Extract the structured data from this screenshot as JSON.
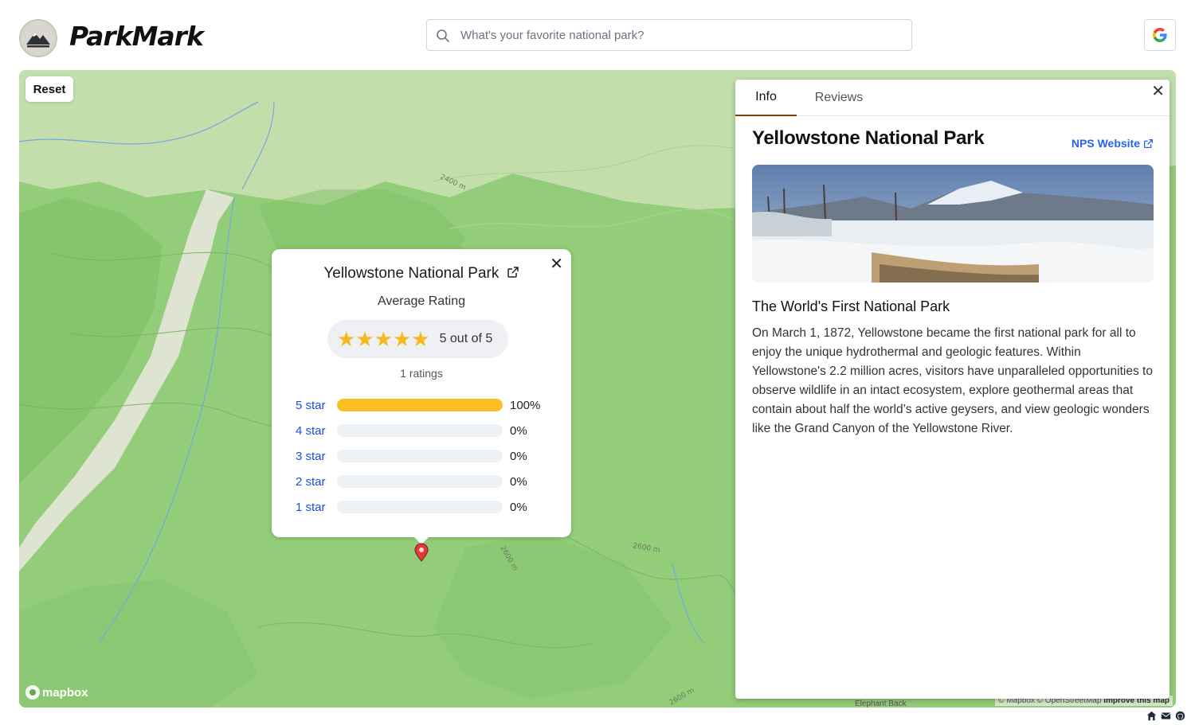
{
  "header": {
    "brand": "ParkMark",
    "search_placeholder": "What's your favorite national park?",
    "google_button_icon": "google-icon"
  },
  "map": {
    "reset_label": "Reset",
    "mapbox_label": "mapbox",
    "attribution_text": "© Mapbox © OpenStreetMap ",
    "attribution_link": "Improve this map",
    "contour_labels": [
      "2400 m",
      "2600 m",
      "2600 m",
      "2600 m"
    ],
    "place_label": "Elephant Back"
  },
  "popup": {
    "title": "Yellowstone National Park",
    "avg_label": "Average Rating",
    "rating": 5,
    "rating_text": "5 out of 5",
    "ratings_count": "1 ratings",
    "histogram": [
      {
        "label": "5 star",
        "fraction": 1.0,
        "pct": "100%"
      },
      {
        "label": "4 star",
        "fraction": 0.0,
        "pct": "0%"
      },
      {
        "label": "3 star",
        "fraction": 0.0,
        "pct": "0%"
      },
      {
        "label": "2 star",
        "fraction": 0.0,
        "pct": "0%"
      },
      {
        "label": "1 star",
        "fraction": 0.0,
        "pct": "0%"
      }
    ]
  },
  "panel": {
    "tabs": [
      {
        "label": "Info",
        "active": true
      },
      {
        "label": "Reviews",
        "active": false
      }
    ],
    "park_title": "Yellowstone National Park",
    "nps_link": "NPS Website",
    "subtitle": "The World's First National Park",
    "description": "On March 1, 1872, Yellowstone became the first national park for all to enjoy the unique hydrothermal and geologic features. Within Yellowstone's 2.2 million acres, visitors have unparalleled opportunities to observe wildlife in an intact ecosystem, explore geothermal areas that contain about half the world’s active geysers, and view geologic wonders like the Grand Canyon of the Yellowstone River."
  },
  "footer": {
    "icons": [
      "home-icon",
      "mail-icon",
      "github-icon"
    ]
  },
  "colors": {
    "map_green": "#93cd79",
    "star": "#f6b81c",
    "bar_fill": "#fbbf24",
    "link_blue": "#1d4ed8",
    "tab_active": "#7b3f12"
  }
}
